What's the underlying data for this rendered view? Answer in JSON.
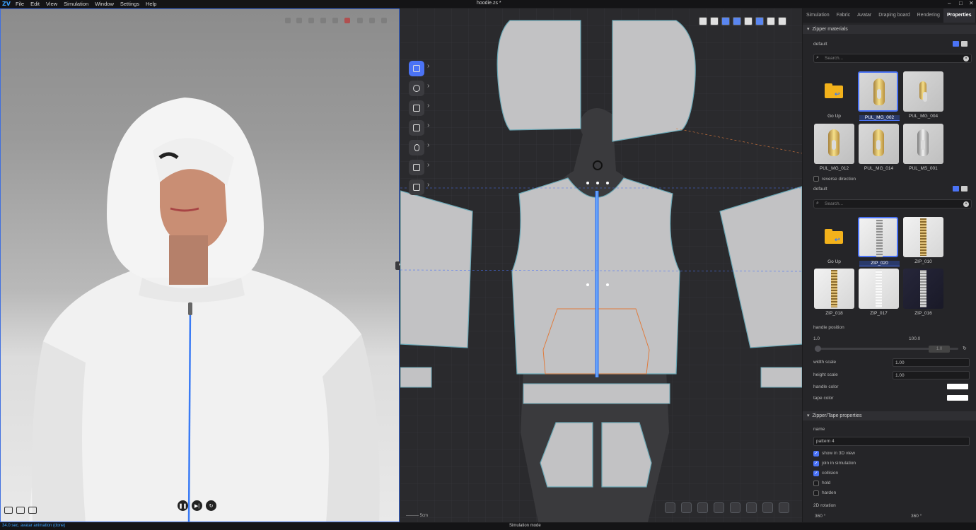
{
  "app": {
    "logo": "ZV",
    "menus": [
      "File",
      "Edit",
      "View",
      "Simulation",
      "Window",
      "Settings",
      "Help"
    ],
    "doc_title": "hoodie.zs *"
  },
  "viewport3d": {
    "player": {
      "pause": "❚❚",
      "step": "▶|",
      "reset": "↻"
    }
  },
  "viewport2d": {
    "scale_label": "5cm",
    "collapse": "▸"
  },
  "panel": {
    "tabs": [
      "Simulation",
      "Fabric",
      "Avatar",
      "Draping board",
      "Rendering",
      "Properties"
    ],
    "zipper_materials": {
      "header": "Zipper materials",
      "folder_label": "default",
      "search_placeholder": "Search...",
      "items": [
        {
          "label": "Go Up",
          "kind": "folder"
        },
        {
          "label": "PUL_MG_002",
          "kind": "gold",
          "selected": true
        },
        {
          "label": "PUL_MG_004",
          "kind": "gold-small"
        },
        {
          "label": "PUL_MG_012",
          "kind": "gold"
        },
        {
          "label": "PUL_MG_014",
          "kind": "gold"
        },
        {
          "label": "PUL_MS_001",
          "kind": "silver"
        }
      ],
      "reverse_direction": "reverse direction",
      "tape_folder_label": "default",
      "tape_search_placeholder": "Search...",
      "tapes": [
        {
          "label": "Go Up",
          "kind": "folder"
        },
        {
          "label": "ZIP_020",
          "kind": "silver-tape",
          "selected": true
        },
        {
          "label": "ZIP_010",
          "kind": "gold-tape"
        },
        {
          "label": "ZIP_018",
          "kind": "gold-tape"
        },
        {
          "label": "ZIP_017",
          "kind": "white"
        },
        {
          "label": "ZIP_016",
          "kind": "dark"
        }
      ],
      "handle_position": {
        "label": "handle position",
        "min": "1.0",
        "max": "100.0",
        "value": "1.0"
      },
      "width_scale": {
        "label": "width scale",
        "value": "1.00"
      },
      "height_scale": {
        "label": "height scale",
        "value": "1.00"
      },
      "handle_color": {
        "label": "handle color",
        "value": "#ffffff"
      },
      "tape_color": {
        "label": "tape color",
        "value": "#ffffff"
      }
    },
    "zipper_tape_properties": {
      "header": "Zipper/Tape properties",
      "name_label": "name",
      "name_value": "pattern 4",
      "checkboxes": [
        {
          "label": "show in 3D view",
          "checked": true
        },
        {
          "label": "join in simulation",
          "checked": true
        },
        {
          "label": "collision",
          "checked": true
        },
        {
          "label": "hold",
          "checked": false
        },
        {
          "label": "harden",
          "checked": false
        }
      ],
      "rotation_label": "2D rotation",
      "rotation_a": "360 °",
      "rotation_b": "360 °"
    }
  },
  "status": {
    "left": "34.0 sec. avatar animation (done)",
    "mid": "Simulation mode"
  },
  "colors": {
    "accent": "#4b73f5",
    "zipper": "#3a7bf5"
  }
}
